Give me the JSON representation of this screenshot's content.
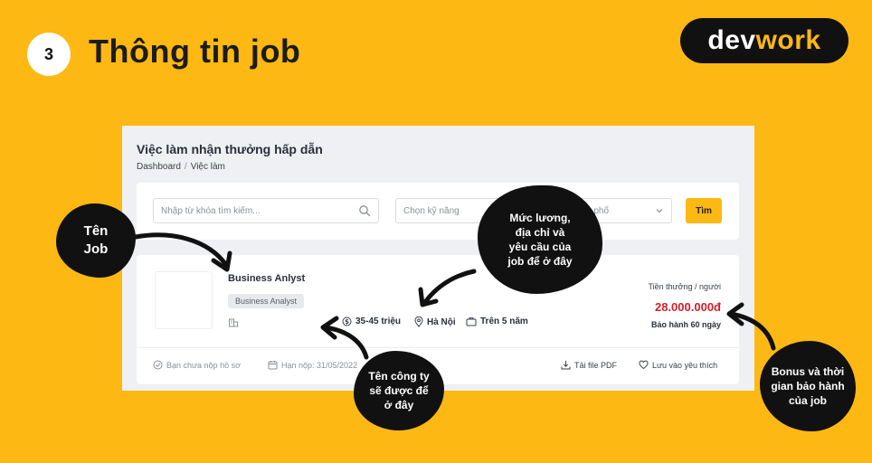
{
  "slide": {
    "step": "3",
    "title": "Thông tin job",
    "logo_dev": "dev",
    "logo_work": "work"
  },
  "app": {
    "title": "Việc làm nhận thưởng hấp dẫn",
    "breadcrumb": [
      "Dashboard",
      "Việc làm"
    ],
    "search": {
      "placeholder": "Nhập từ khóa tìm kiếm...",
      "skill_placeholder": "Chọn kỹ năng",
      "city_placeholder": "h phố",
      "button": "Tìm"
    },
    "job": {
      "title": "Business Anlyst",
      "tag": "Business Analyst",
      "salary": "35-45 triệu",
      "location": "Hà Nội",
      "experience": "Trên 5 năm",
      "bonus_label": "Tiền thưởng / người",
      "bonus_amount": "28.000.000đ",
      "warranty": "Bảo hành 60 ngày",
      "cv_status": "Bạn chưa nộp hồ sơ",
      "deadline": "Hạn nộp: 31/05/2022",
      "download": "Tải file PDF",
      "save": "Lưu vào yêu thích"
    }
  },
  "callouts": {
    "job": [
      "Tên",
      "Job"
    ],
    "salary": [
      "Mức lương,",
      "địa chỉ và",
      "yêu cầu của",
      "job để ở đây"
    ],
    "company": [
      "Tên công ty",
      "sẽ được để",
      "ở đây"
    ],
    "bonus": [
      "Bonus và thời",
      "gian bảo hành",
      "của job"
    ]
  },
  "colors": {
    "background": "#FDB813",
    "accent": "#FDB813",
    "bonus": "#d41f2c",
    "callout": "#111111"
  }
}
